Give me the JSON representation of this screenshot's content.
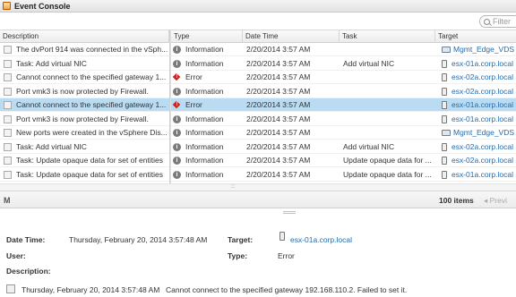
{
  "title": "Event Console",
  "filter": {
    "placeholder": "Filter"
  },
  "columns": [
    "Description",
    "Type",
    "Date Time",
    "Task",
    "Target"
  ],
  "rows": [
    {
      "description": "The dvPort 914 was connected in the vSph...",
      "type": "Information",
      "date": "2/20/2014 3:57 AM",
      "task": "",
      "target": "Mgmt_Edge_VDS",
      "target_kind": "switch"
    },
    {
      "description": "Task: Add virtual NIC",
      "type": "Information",
      "date": "2/20/2014 3:57 AM",
      "task": "Add virtual NIC",
      "target": "esx-01a.corp.local",
      "target_kind": "host"
    },
    {
      "description": "Cannot connect to the specified gateway 1...",
      "type": "Error",
      "date": "2/20/2014 3:57 AM",
      "task": "",
      "target": "esx-02a.corp.local",
      "target_kind": "host"
    },
    {
      "description": "Port vmk3 is now protected by Firewall.",
      "type": "Information",
      "date": "2/20/2014 3:57 AM",
      "task": "",
      "target": "esx-02a.corp.local",
      "target_kind": "host"
    },
    {
      "description": "Cannot connect to the specified gateway 1...",
      "type": "Error",
      "date": "2/20/2014 3:57 AM",
      "task": "",
      "target": "esx-01a.corp.local",
      "target_kind": "host",
      "selected": true
    },
    {
      "description": "Port vmk3 is now protected by Firewall.",
      "type": "Information",
      "date": "2/20/2014 3:57 AM",
      "task": "",
      "target": "esx-01a.corp.local",
      "target_kind": "host"
    },
    {
      "description": "New ports were created in the vSphere Dis...",
      "type": "Information",
      "date": "2/20/2014 3:57 AM",
      "task": "",
      "target": "Mgmt_Edge_VDS",
      "target_kind": "switch"
    },
    {
      "description": "Task: Add virtual NIC",
      "type": "Information",
      "date": "2/20/2014 3:57 AM",
      "task": "Add virtual NIC",
      "target": "esx-02a.corp.local",
      "target_kind": "host"
    },
    {
      "description": "Task: Update opaque data for set of entities",
      "type": "Information",
      "date": "2/20/2014 3:57 AM",
      "task": "Update opaque data for ...",
      "target": "esx-02a.corp.local",
      "target_kind": "host"
    },
    {
      "description": "Task: Update opaque data for set of entities",
      "type": "Information",
      "date": "2/20/2014 3:57 AM",
      "task": "Update opaque data for ...",
      "target": "esx-01a.corp.local",
      "target_kind": "host"
    }
  ],
  "footer": {
    "count": "100 items",
    "previous": "Previ"
  },
  "details": {
    "date_time_label": "Date Time:",
    "date_time_value": "Thursday, February 20, 2014 3:57:48 AM",
    "target_label": "Target:",
    "target_value": "esx-01a.corp.local",
    "user_label": "User:",
    "type_label": "Type:",
    "type_value": "Error",
    "description_label": "Description:",
    "message_time": "Thursday, February 20, 2014 3:57:48 AM",
    "message_text": "Cannot connect to the specified gateway 192.168.110.2. Failed to set it."
  },
  "colors": {
    "selection": "#b9dcf3",
    "link": "#1f6bb2",
    "error": "#cc2222"
  }
}
